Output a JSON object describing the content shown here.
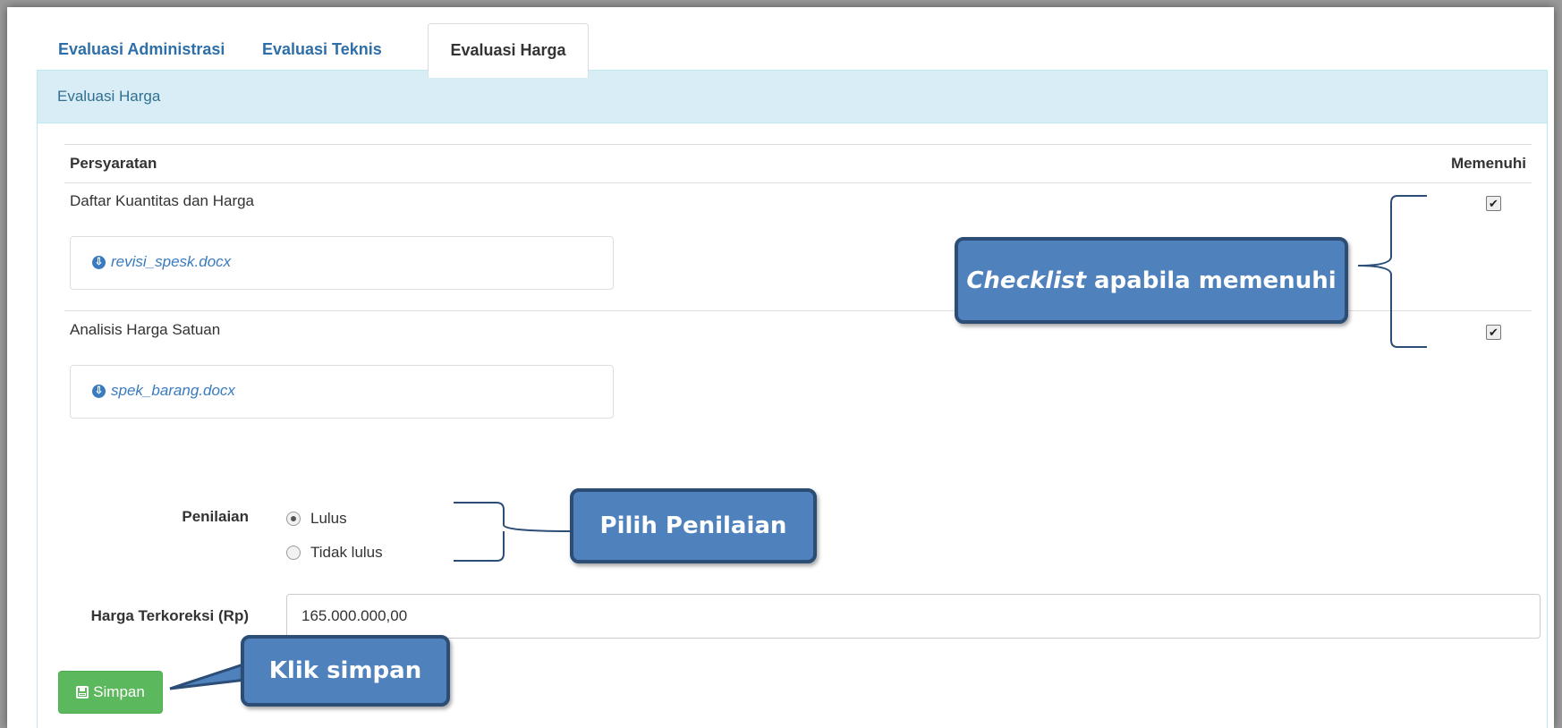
{
  "tabs": [
    {
      "label": "Evaluasi Administrasi",
      "active": false
    },
    {
      "label": "Evaluasi Teknis",
      "active": false
    },
    {
      "label": "Evaluasi Harga",
      "active": true
    }
  ],
  "panel": {
    "heading": "Evaluasi Harga",
    "table": {
      "col_persyaratan": "Persyaratan",
      "col_memenuhi": "Memenuhi",
      "rows": [
        {
          "label": "Daftar Kuantitas dan Harga",
          "file": "revisi_spesk.docx",
          "checked": true
        },
        {
          "label": "Analisis Harga Satuan",
          "file": "spek_barang.docx",
          "checked": true
        }
      ]
    },
    "penilaian": {
      "label": "Penilaian",
      "options": [
        {
          "label": "Lulus",
          "selected": true
        },
        {
          "label": "Tidak lulus",
          "selected": false
        }
      ]
    },
    "harga": {
      "label": "Harga Terkoreksi (Rp)",
      "value": "165.000.000,00"
    },
    "save_label": "Simpan"
  },
  "callouts": {
    "checklist_italic": "Checklist",
    "checklist_rest": "apabila memenuhi",
    "pilih": "Pilih Penilaian",
    "klik": "Klik simpan"
  },
  "colors": {
    "callout_fill": "#4f81bd",
    "callout_border": "#2c4d75",
    "success": "#5cb85c",
    "link": "#3a7bbf",
    "panel_heading_bg": "#d9edf7"
  },
  "icons": {
    "download": "download-circle-icon",
    "save": "floppy-disk-icon",
    "check": "check-icon"
  }
}
